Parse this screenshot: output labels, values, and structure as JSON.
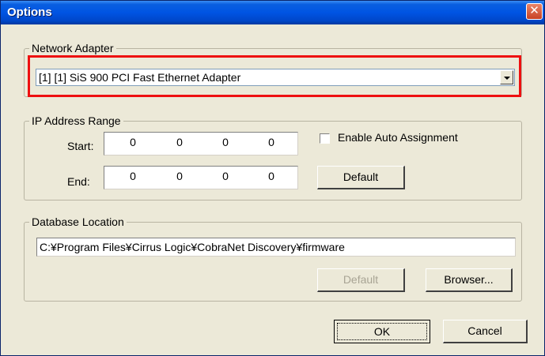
{
  "window": {
    "title": "Options",
    "close_symbol": "✕"
  },
  "network_adapter": {
    "legend": "Network Adapter",
    "selected": "[1] [1] SiS 900 PCI Fast Ethernet Adapter",
    "highlight_color": "#ee1010"
  },
  "ip_range": {
    "legend": "IP Address Range",
    "start_label": "Start:",
    "end_label": "End:",
    "start": [
      "0",
      "0",
      "0",
      "0"
    ],
    "end": [
      "0",
      "0",
      "0",
      "0"
    ],
    "auto_assign_label": "Enable Auto Assignment",
    "auto_assign_checked": false,
    "default_label": "Default"
  },
  "database": {
    "legend": "Database Location",
    "path": "C:¥Program Files¥Cirrus Logic¥CobraNet Discovery¥firmware",
    "default_label": "Default",
    "browse_label": "Browser..."
  },
  "footer": {
    "ok_label": "OK",
    "cancel_label": "Cancel"
  }
}
